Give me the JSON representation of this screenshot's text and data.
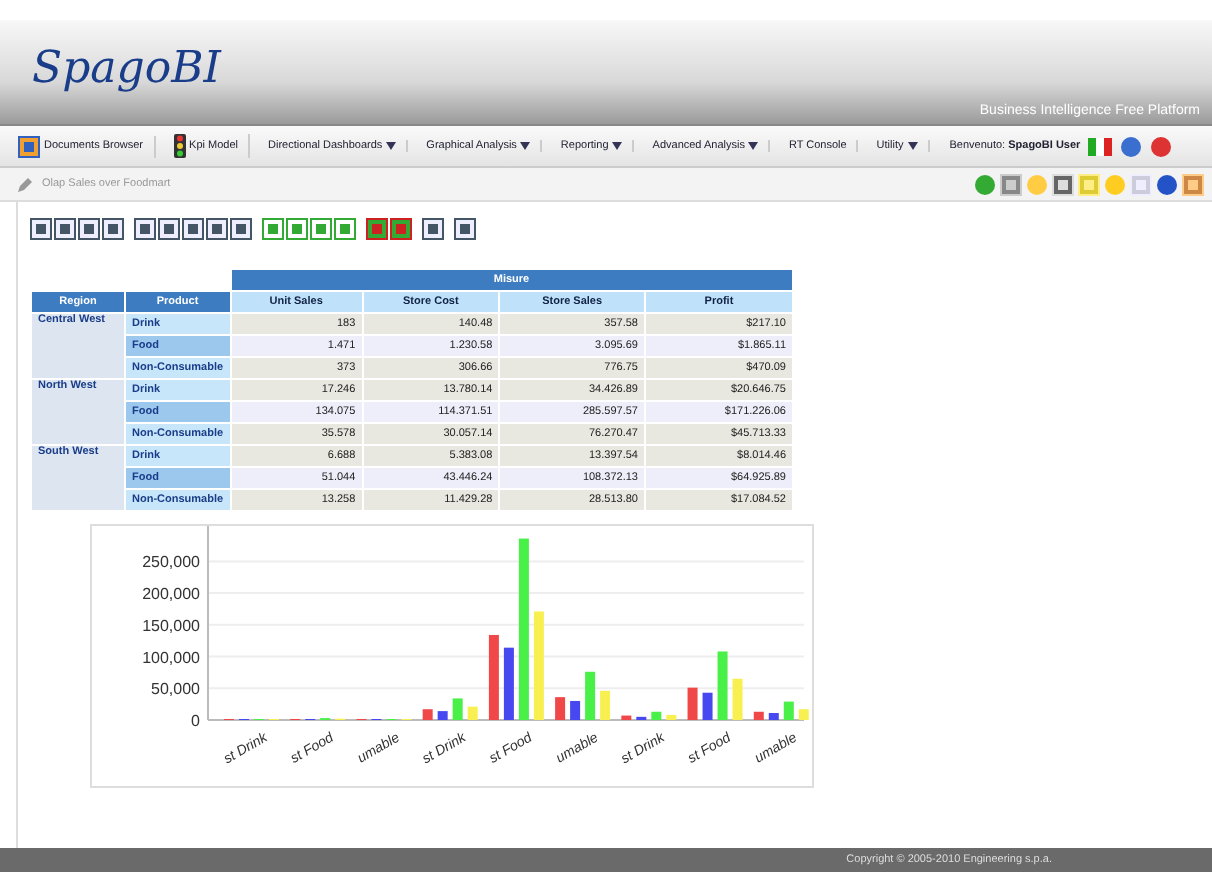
{
  "header": {
    "logo": "SpagoBI",
    "tagline": "Business Intelligence Free Platform"
  },
  "menu": [
    {
      "label": "Documents Browser",
      "dropdown": false
    },
    {
      "label": "Kpi Model",
      "dropdown": false
    },
    {
      "label": "Directional Dashboards",
      "dropdown": true
    },
    {
      "label": "Graphical Analysis",
      "dropdown": true
    },
    {
      "label": "Reporting",
      "dropdown": true
    },
    {
      "label": "Advanced Analysis",
      "dropdown": true
    },
    {
      "label": "RT Console",
      "dropdown": false
    },
    {
      "label": "Utility",
      "dropdown": true
    }
  ],
  "user": {
    "prefix": "Benvenuto:",
    "name": "SpagoBI User"
  },
  "document_bar": {
    "title": "Olap Sales over Foodmart"
  },
  "pivot": {
    "measures_header": "Misure",
    "row_headers": [
      "Region",
      "Product"
    ],
    "columns": [
      "Unit Sales",
      "Store Cost",
      "Store Sales",
      "Profit"
    ],
    "groups": [
      {
        "region": "Central West",
        "rows": [
          {
            "product": "Drink",
            "values": [
              "183",
              "140.48",
              "357.58",
              "$217.10"
            ]
          },
          {
            "product": "Food",
            "values": [
              "1.471",
              "1.230.58",
              "3.095.69",
              "$1.865.11"
            ]
          },
          {
            "product": "Non-Consumable",
            "values": [
              "373",
              "306.66",
              "776.75",
              "$470.09"
            ]
          }
        ]
      },
      {
        "region": "North West",
        "rows": [
          {
            "product": "Drink",
            "values": [
              "17.246",
              "13.780.14",
              "34.426.89",
              "$20.646.75"
            ]
          },
          {
            "product": "Food",
            "values": [
              "134.075",
              "114.371.51",
              "285.597.57",
              "$171.226.06"
            ]
          },
          {
            "product": "Non-Consumable",
            "values": [
              "35.578",
              "30.057.14",
              "76.270.47",
              "$45.713.33"
            ]
          }
        ]
      },
      {
        "region": "South West",
        "rows": [
          {
            "product": "Drink",
            "values": [
              "6.688",
              "5.383.08",
              "13.397.54",
              "$8.014.46"
            ]
          },
          {
            "product": "Food",
            "values": [
              "51.044",
              "43.446.24",
              "108.372.13",
              "$64.925.89"
            ]
          },
          {
            "product": "Non-Consumable",
            "values": [
              "13.258",
              "11.429.28",
              "28.513.80",
              "$17.084.52"
            ]
          }
        ]
      }
    ]
  },
  "chart_data": {
    "type": "bar",
    "grid": true,
    "categories": [
      "st Drink",
      "st Food",
      "umable",
      "st Drink",
      "st Food",
      "umable",
      "st Drink",
      "st Food",
      "umable"
    ],
    "ylim": [
      0,
      290000
    ],
    "yticks": [
      {
        "value": 0,
        "label": "0"
      },
      {
        "value": 50000,
        "label": "50,000"
      },
      {
        "value": 100000,
        "label": "100,000"
      },
      {
        "value": 150000,
        "label": "150,000"
      },
      {
        "value": 200000,
        "label": "200,000"
      },
      {
        "value": 250000,
        "label": "250,000"
      }
    ],
    "series": [
      {
        "color": "#f04848",
        "values": [
          0,
          1000,
          0,
          17000,
          134000,
          36000,
          7000,
          51000,
          13000
        ]
      },
      {
        "color": "#4848f0",
        "values": [
          0,
          1000,
          0,
          14000,
          114000,
          30000,
          5000,
          43000,
          11000
        ]
      },
      {
        "color": "#48f048",
        "values": [
          0,
          3000,
          1000,
          34000,
          286000,
          76000,
          13000,
          108000,
          29000
        ]
      },
      {
        "color": "#f8f050",
        "values": [
          0,
          2000,
          0,
          21000,
          171000,
          46000,
          8000,
          65000,
          17000
        ]
      }
    ]
  },
  "footer": {
    "text": "Copyright © 2005-2010 Engineering s.p.a."
  }
}
